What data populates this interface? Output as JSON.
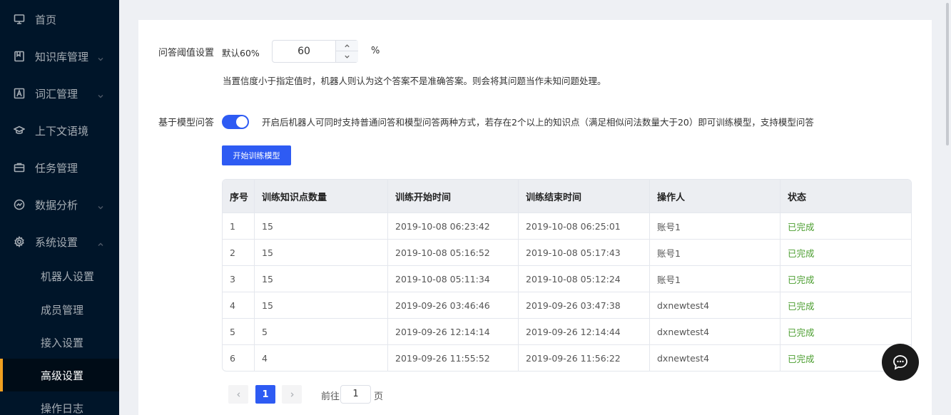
{
  "sidebar": {
    "items": [
      {
        "label": "首页",
        "icon": "monitor-icon"
      },
      {
        "label": "知识库管理",
        "icon": "book-icon"
      },
      {
        "label": "词汇管理",
        "icon": "vocab-icon"
      },
      {
        "label": "上下文语境",
        "icon": "graduation-cap-icon"
      },
      {
        "label": "任务管理",
        "icon": "briefcase-icon"
      },
      {
        "label": "数据分析",
        "icon": "chart-circle-icon"
      },
      {
        "label": "系统设置",
        "icon": "gear-icon"
      }
    ],
    "sub_items": [
      {
        "label": "机器人设置"
      },
      {
        "label": "成员管理"
      },
      {
        "label": "接入设置"
      },
      {
        "label": "高级设置"
      },
      {
        "label": "操作日志"
      }
    ],
    "active_item": "高级设置",
    "colors": {
      "background": "#001529",
      "active_bar": "#f0a020"
    }
  },
  "threshold": {
    "label": "问答阈值设置",
    "default_text": "默认60%",
    "value": "60",
    "unit": "%",
    "hint": "当置信度小于指定值时，机器人则认为这个答案不是准确答案。则会将其问题当作未知问题处理。"
  },
  "model_qa": {
    "label": "基于模型问答",
    "enabled": true,
    "description": "开启后机器人可同时支持普通问答和模型问答两种方式，若存在2个以上的知识点（满足相似问法数量大于20）即可训练模型，支持模型问答",
    "train_button": "开始训练模型"
  },
  "table": {
    "headers": [
      "序号",
      "训练知识点数量",
      "训练开始时间",
      "训练结束时间",
      "操作人",
      "状态"
    ],
    "rows": [
      [
        "1",
        "15",
        "2019-10-08 06:23:42",
        "2019-10-08 06:25:01",
        "账号1",
        "已完成"
      ],
      [
        "2",
        "15",
        "2019-10-08 05:16:52",
        "2019-10-08 05:17:43",
        "账号1",
        "已完成"
      ],
      [
        "3",
        "15",
        "2019-10-08 05:11:34",
        "2019-10-08 05:12:24",
        "账号1",
        "已完成"
      ],
      [
        "4",
        "15",
        "2019-09-26 03:46:46",
        "2019-09-26 03:47:38",
        "dxnewtest4",
        "已完成"
      ],
      [
        "5",
        "5",
        "2019-09-26 12:14:14",
        "2019-09-26 12:14:44",
        "dxnewtest4",
        "已完成"
      ],
      [
        "6",
        "4",
        "2019-09-26 11:55:52",
        "2019-09-26 11:56:22",
        "dxnewtest4",
        "已完成"
      ]
    ],
    "status_color": "#4a9d2e"
  },
  "pagination": {
    "current_page": "1",
    "goto_label": "前往",
    "goto_value": "1",
    "page_suffix": "页"
  },
  "accent_color": "#2e5bf3"
}
